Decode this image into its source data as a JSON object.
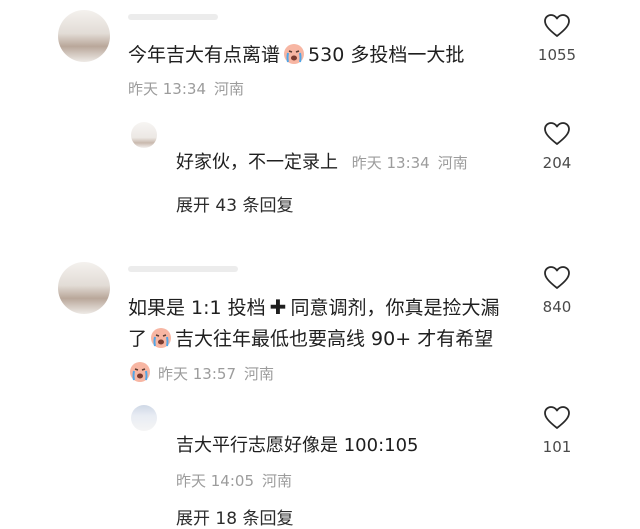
{
  "comments": [
    {
      "text_before": "今年吉大有点离谱",
      "text_after": "530 多投档一大批",
      "time": "昨天 13:34",
      "location": "河南",
      "likes": "1055",
      "reply": {
        "text": "好家伙，不一定录上",
        "time": "昨天 13:34",
        "location": "河南",
        "likes": "204",
        "expand": "展开 43 条回复"
      }
    },
    {
      "line1_before": "如果是 1:1 投档",
      "line1_after": "同意调剂，你真是捡大漏",
      "line2_start": "了",
      "line2_rest": "吉大往年最低也要高线 90+ 才有希望",
      "time": "昨天 13:57",
      "location": "河南",
      "likes": "840",
      "reply": {
        "text": "吉大平行志愿好像是 100:105",
        "time": "昨天 14:05",
        "location": "河南",
        "likes": "101",
        "expand": "展开 18 条回复"
      }
    }
  ],
  "icons": {
    "like": "heart-outline-icon",
    "emoji": "crying-face-emoji",
    "plus": "heavy-plus-icon"
  },
  "colors": {
    "meta": "#9c9c9c",
    "text": "#1f1f1f",
    "emoji_face": "#f7b6a3"
  }
}
